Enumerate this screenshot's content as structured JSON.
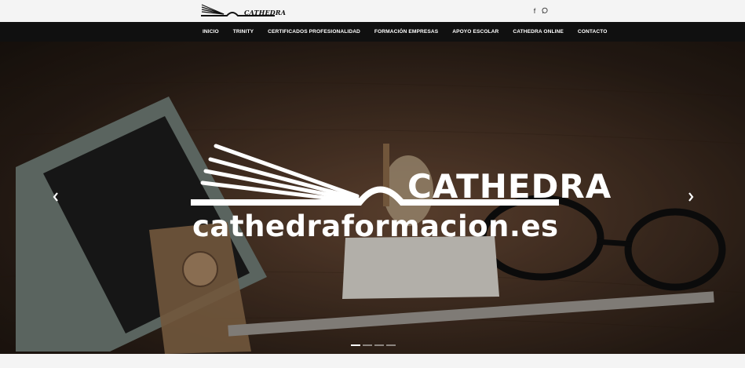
{
  "header": {
    "logo_text": "CATHEDRA",
    "social": [
      {
        "icon": "facebook-icon",
        "glyph": "f"
      },
      {
        "icon": "whatsapp-icon",
        "glyph": "◌"
      }
    ]
  },
  "nav": {
    "items": [
      "INICIO",
      "TRINITY",
      "CERTIFICADOS PROFESIONALIDAD",
      "FORMACIÓN EMPRESAS",
      "APOYO ESCOLAR",
      "CATHEDRA ONLINE",
      "CONTACTO"
    ]
  },
  "hero": {
    "title": "CATHEDRA",
    "subtitle": "cathedraformacion.es",
    "prev_glyph": "‹",
    "next_glyph": "›",
    "slides_count": 4,
    "active_slide": 1,
    "colors": {
      "overlay_text": "#ffffff",
      "nav_bg": "#101010",
      "wood": "#5a3f2d"
    }
  }
}
